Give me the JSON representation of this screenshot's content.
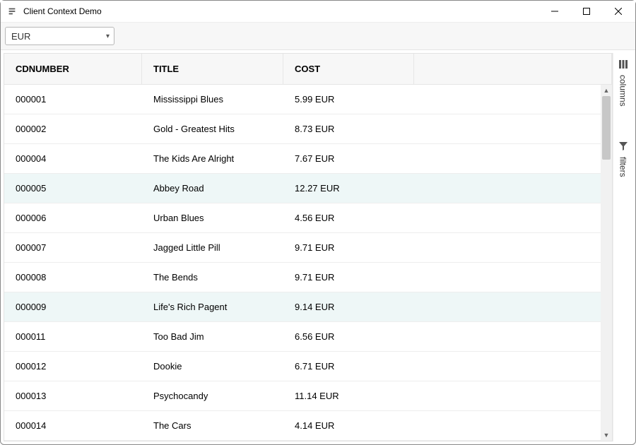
{
  "window": {
    "title": "Client Context Demo"
  },
  "toolbar": {
    "currency_selected": "EUR"
  },
  "grid": {
    "columns": [
      "CDNUMBER",
      "TITLE",
      "COST"
    ],
    "rows": [
      {
        "cdnumber": "000001",
        "title": "Mississippi Blues",
        "cost": "5.99 EUR",
        "highlight": false
      },
      {
        "cdnumber": "000002",
        "title": "Gold - Greatest Hits",
        "cost": "8.73 EUR",
        "highlight": false
      },
      {
        "cdnumber": "000004",
        "title": "The Kids Are Alright",
        "cost": "7.67 EUR",
        "highlight": false
      },
      {
        "cdnumber": "000005",
        "title": "Abbey Road",
        "cost": "12.27 EUR",
        "highlight": true
      },
      {
        "cdnumber": "000006",
        "title": "Urban Blues",
        "cost": "4.56 EUR",
        "highlight": false
      },
      {
        "cdnumber": "000007",
        "title": "Jagged Little Pill",
        "cost": "9.71 EUR",
        "highlight": false
      },
      {
        "cdnumber": "000008",
        "title": "The Bends",
        "cost": "9.71 EUR",
        "highlight": false
      },
      {
        "cdnumber": "000009",
        "title": "Life's Rich Pagent",
        "cost": "9.14 EUR",
        "highlight": true
      },
      {
        "cdnumber": "000011",
        "title": "Too Bad Jim",
        "cost": "6.56 EUR",
        "highlight": false
      },
      {
        "cdnumber": "000012",
        "title": "Dookie",
        "cost": "6.71 EUR",
        "highlight": false
      },
      {
        "cdnumber": "000013",
        "title": "Psychocandy",
        "cost": "11.14 EUR",
        "highlight": false
      },
      {
        "cdnumber": "000014",
        "title": "The Cars",
        "cost": "4.14 EUR",
        "highlight": false
      }
    ]
  },
  "sidebar": {
    "columns_label": "columns",
    "filters_label": "filters"
  }
}
